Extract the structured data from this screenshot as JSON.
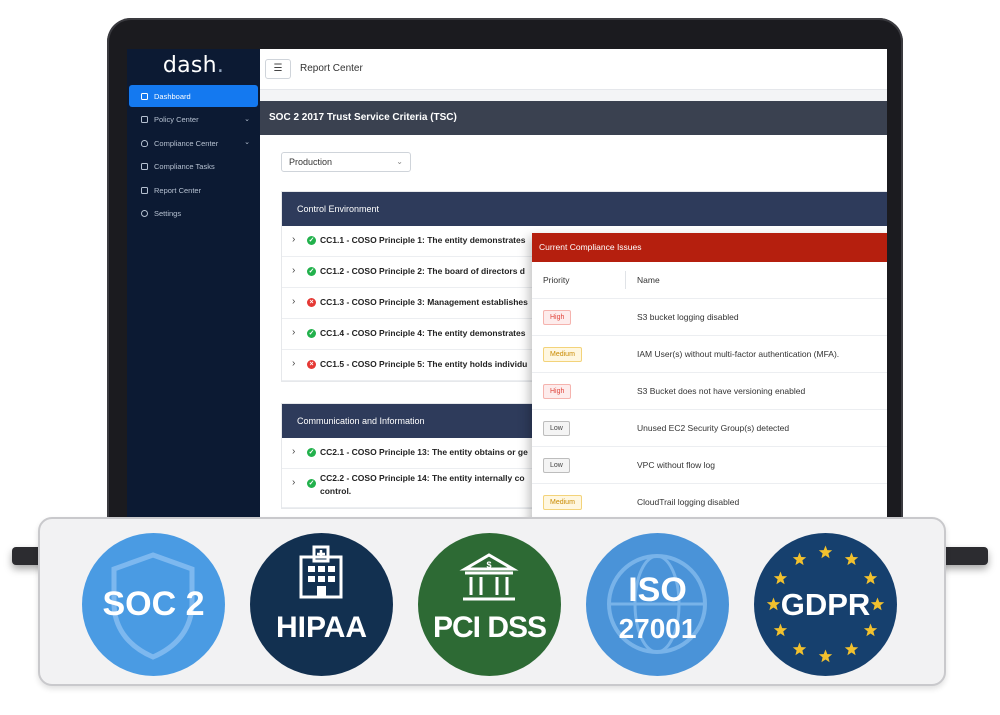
{
  "app": {
    "logo_text": "dash",
    "logo_dot": "."
  },
  "sidebar": {
    "items": [
      {
        "label": "Dashboard",
        "active": true,
        "icon": "monitor-icon"
      },
      {
        "label": "Policy Center",
        "expandable": true,
        "icon": "document-icon"
      },
      {
        "label": "Compliance Center",
        "expandable": true,
        "icon": "shield-icon"
      },
      {
        "label": "Compliance Tasks",
        "icon": "checkbox-icon"
      },
      {
        "label": "Report Center",
        "icon": "folder-icon"
      },
      {
        "label": "Settings",
        "icon": "gear-icon"
      }
    ]
  },
  "header": {
    "menu_icon": "hamburger-icon",
    "breadcrumb": "Report Center"
  },
  "report": {
    "title": "SOC 2 2017 Trust Service Criteria (TSC)",
    "environment": "Production"
  },
  "sections": [
    {
      "title": "Control Environment",
      "rows": [
        {
          "status": "pass",
          "text": "CC1.1 - COSO Principle 1: The entity demonstrates"
        },
        {
          "status": "pass",
          "text": "CC1.2 - COSO Principle 2: The board of directors d"
        },
        {
          "status": "fail",
          "text": "CC1.3 - COSO Principle 3: Management establishes"
        },
        {
          "status": "pass",
          "text": "CC1.4 - COSO Principle 4: The entity demonstrates"
        },
        {
          "status": "fail",
          "text": "CC1.5 - COSO Principle 5: The entity holds individu"
        }
      ]
    },
    {
      "title": "Communication and Information",
      "rows": [
        {
          "status": "pass",
          "text": "CC2.1 - COSO Principle 13: The entity obtains or ge"
        },
        {
          "status": "pass",
          "text": "CC2.2 - COSO Principle 14: The entity internally co",
          "text2": "control."
        }
      ]
    }
  ],
  "issues": {
    "title": "Current Compliance Issues",
    "columns": [
      "Priority",
      "Name"
    ],
    "rows": [
      {
        "priority": "High",
        "name": "S3 bucket logging disabled"
      },
      {
        "priority": "Medium",
        "name": "IAM User(s) without multi-factor authentication (MFA)."
      },
      {
        "priority": "High",
        "name": "S3 Bucket does not have versioning enabled"
      },
      {
        "priority": "Low",
        "name": "Unused EC2 Security Group(s) detected"
      },
      {
        "priority": "Low",
        "name": "VPC without flow log"
      },
      {
        "priority": "Medium",
        "name": "CloudTrail logging disabled"
      }
    ]
  },
  "certifications": [
    {
      "label": "SOC 2",
      "icon": "shield-icon",
      "color": "#4a9be3"
    },
    {
      "label": "HIPAA",
      "icon": "hospital-icon",
      "color": "#123050"
    },
    {
      "label": "PCI DSS",
      "icon": "bank-icon",
      "color": "#2d6a34"
    },
    {
      "label": "ISO",
      "label2": "27001",
      "icon": "globe-icon",
      "color": "#4a93d8"
    },
    {
      "label": "GDPR",
      "icon": "eu-stars-icon",
      "color": "#16406e"
    }
  ],
  "colors": {
    "sidebar_bg": "#0c1a33",
    "active_nav": "#1479f0",
    "section_header": "#2e3b5b",
    "issues_header": "#b51f0e",
    "pass": "#22b14c",
    "fail": "#e53935",
    "star": "#f2c12e"
  }
}
